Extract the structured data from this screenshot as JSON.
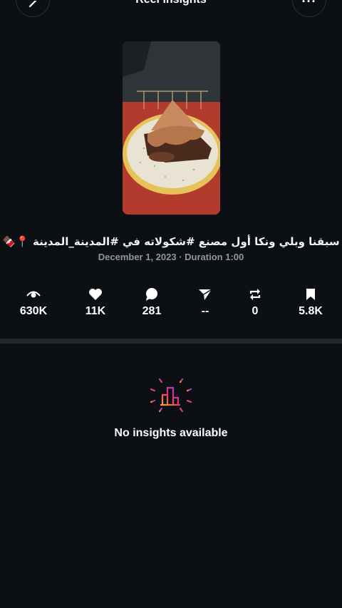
{
  "header": {
    "title": "Reel insights",
    "back_icon": "chevron-left-icon",
    "more_label": "···"
  },
  "reel": {
    "caption": "سبقنا وبلي ونكا أول مصنع #شكولاته في #المدينة_المدينة 📍🍫",
    "meta": "December 1, 2023 · Duration 1:00"
  },
  "stats": [
    {
      "icon": "eye-icon",
      "value": "630K"
    },
    {
      "icon": "heart-icon",
      "value": "11K"
    },
    {
      "icon": "comment-icon",
      "value": "281"
    },
    {
      "icon": "share-icon",
      "value": "--"
    },
    {
      "icon": "repost-icon",
      "value": "0"
    },
    {
      "icon": "bookmark-icon",
      "value": "5.8K"
    }
  ],
  "empty_state": {
    "icon": "insights-chart-icon",
    "text": "No insights available"
  }
}
